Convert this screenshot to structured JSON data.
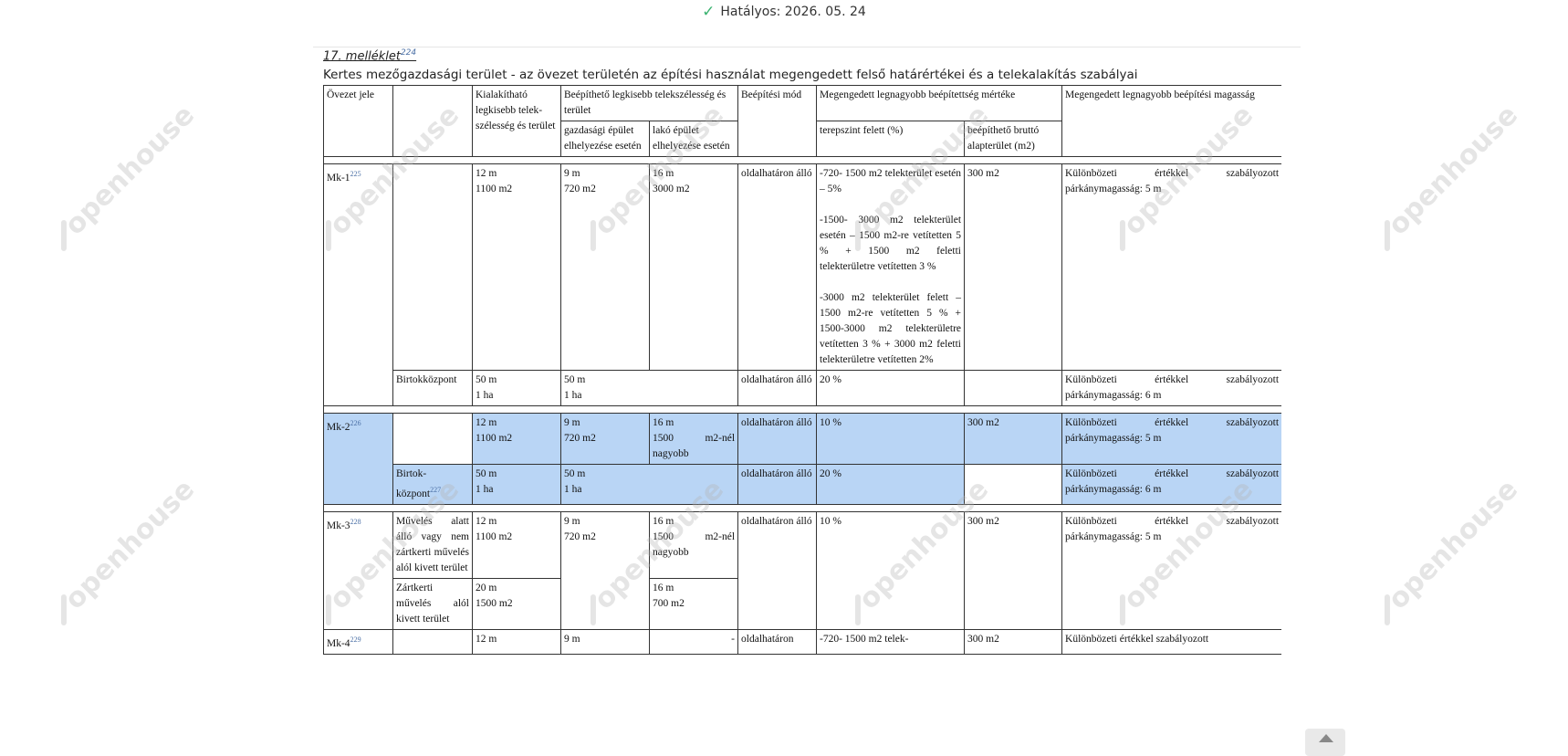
{
  "status": {
    "label": "Hatályos: 2026. 05. 24"
  },
  "annex": {
    "title": "17. melléklet",
    "ref": "224"
  },
  "caption": "Kertes mezőgazdasági terület - az övezet területén az építési használat megengedett felső határértékei és a telekalakítás szabályai",
  "watermark": "openhouse",
  "header": {
    "zone": "Övezet jele",
    "min_plot": "Kialakítható legkisebb telek-szélesség és terület",
    "buildable": "Beépíthető legkisebb telekszélesség és terület",
    "buildable_econ": "gazdasági épület elhelyezése esetén",
    "buildable_res": "lakó épület elhelyezése esetén",
    "mode": "Beépítési mód",
    "max_coverage": "Megengedett legnagyobb beépítettség mértéke",
    "above_ground": "terepszint felett (%)",
    "gross_area": "beépíthető bruttó alapterület (m2)",
    "max_height": "Megengedett legnagyobb beépítési magasság"
  },
  "rows": {
    "mk1": {
      "zone": "Mk-1",
      "ref": "225",
      "min_plot": [
        "12 m",
        "1100 m2"
      ],
      "econ": [
        "9 m",
        "720 m2"
      ],
      "res": [
        "16 m",
        "3000 m2"
      ],
      "mode": "oldalhatáron álló",
      "coverage": [
        "-720- 1500 m2 telekterület esetén – 5%",
        "-1500- 3000 m2 telekterület esetén – 1500 m2-re vetítetten 5 % + 1500 m2 feletti telekterületre vetítetten 3 %",
        "-3000 m2 telekterület felett – 1500 m2-re vetítetten 5 % + 1500-3000 m2 telekterületre vetítetten 3 % + 3000 m2 feletti telekterületre vetítetten 2%"
      ],
      "gross": "300 m2",
      "height": "Különbözeti értékkel szabályozott párkánymagasság: 5 m"
    },
    "mk1b": {
      "sub": "Birtokközpont",
      "min_plot": [
        "50 m",
        "1 ha"
      ],
      "build": [
        "50 m",
        "1 ha"
      ],
      "mode": "oldalhatáron álló",
      "coverage": "20 %",
      "height": "Különbözeti értékkel szabályozott párkánymagasság: 6 m"
    },
    "mk2": {
      "zone": "Mk-2",
      "ref": "226",
      "min_plot": [
        "12 m",
        "1100 m2"
      ],
      "econ": [
        "9 m",
        "720 m2"
      ],
      "res": [
        "16 m",
        "1500 m2-nél nagyobb"
      ],
      "mode": "oldalhatáron álló",
      "coverage": "10 %",
      "gross": "300 m2",
      "height": "Különbözeti értékkel szabályozott párkánymagasság: 5 m"
    },
    "mk2b": {
      "sub": [
        "Birtok-",
        "központ"
      ],
      "ref": "227",
      "min_plot": [
        "50 m",
        "1 ha"
      ],
      "build": [
        "50 m",
        "1 ha"
      ],
      "mode": "oldalhatáron álló",
      "coverage": "20 %",
      "height": "Különbözeti értékkel szabályozott párkánymagasság: 6 m"
    },
    "mk3": {
      "zone": "Mk-3",
      "ref": "228",
      "sub1": "Művelés alatt álló vagy nem zártkerti művelés alól kivett terület",
      "min_plot1": [
        "12 m",
        "1100 m2"
      ],
      "econ": [
        "9 m",
        "720 m2"
      ],
      "res1": [
        "16 m",
        "1500 m2-nél nagyobb"
      ],
      "mode": "oldalhatáron álló",
      "coverage": "10 %",
      "gross": "300 m2",
      "height": "Különbözeti értékkel szabályozott párkánymagasság: 5 m",
      "sub2": "Zártkerti művelés alól kivett terület",
      "min_plot2": [
        "20 m",
        "1500 m2"
      ],
      "res2": [
        "16 m",
        "700 m2"
      ]
    },
    "mk4": {
      "zone": "Mk-4",
      "ref": "229",
      "min_plot": "12 m",
      "econ": "9 m",
      "res": "-",
      "mode": "oldalhatáron",
      "coverage": "-720- 1500 m2 telek-",
      "gross": "300 m2",
      "height": "Különbözeti értékkel szabályozott"
    }
  }
}
